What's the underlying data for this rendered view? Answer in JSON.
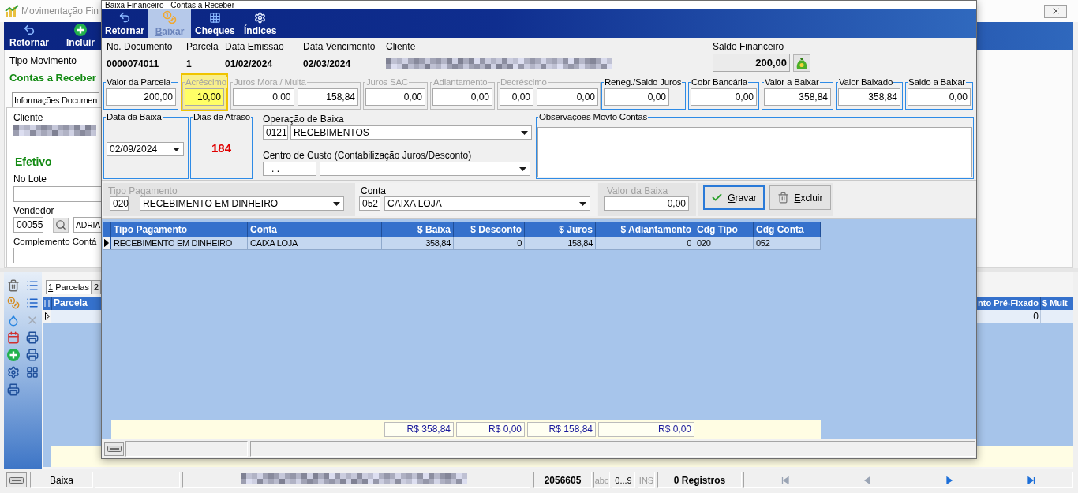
{
  "background_window": {
    "title": "Movimentação Fin",
    "toolbar": [
      {
        "label": "Retornar",
        "accelerator": false
      },
      {
        "label": "Incluir",
        "accelerator": true
      }
    ],
    "tipo_movimento": {
      "label": "Tipo Movimento",
      "value": "Contas a Receber"
    },
    "tabs": [
      {
        "label": "Informações Documen",
        "selected": true
      }
    ],
    "cliente": {
      "label": "Cliente",
      "redacted": true
    },
    "situacao": "Efetivo",
    "no_lote": {
      "label": "No Lote"
    },
    "vendedor": {
      "label": "Vendedor",
      "code": "00055",
      "name": "ADRIA"
    },
    "complemento": {
      "label": "Complemento Contá"
    },
    "side_tools": [
      {
        "disabled": false
      },
      {
        "disabled": false
      },
      {
        "disabled": false
      },
      {
        "disabled": false
      },
      {
        "disabled": false
      },
      {
        "disabled": true
      },
      {
        "disabled": false
      },
      {
        "disabled": false
      },
      {
        "disabled": false
      },
      {
        "disabled": false
      },
      {
        "disabled": false
      },
      {
        "disabled": false
      },
      {
        "disabled": false
      }
    ],
    "grid_tabs": [
      {
        "label": "1 Parcelas",
        "selected": true,
        "accelerator": true
      },
      {
        "label": "2",
        "selected": false,
        "accelerator": false
      }
    ],
    "grid": {
      "columns": [
        "Parcela",
        "nto Pré-Fixado",
        "$ Mult"
      ],
      "rows": [
        {
          "selected": false,
          "column_2": "0"
        }
      ]
    },
    "status_bar": {
      "mode": "Baixa",
      "redacted": true,
      "number": "2056605",
      "indicators": [
        {
          "label": "abc",
          "on": false
        },
        {
          "label": "0...9",
          "on": true
        },
        {
          "label": "INS",
          "on": false
        }
      ],
      "records": "0 Registros",
      "navigator": [
        {
          "disabled": true
        },
        {
          "disabled": true
        },
        {
          "disabled": false
        },
        {
          "disabled": false
        }
      ]
    }
  },
  "dialog": {
    "title": "Baixa Financeiro - Contas a Receber",
    "toolbar": [
      {
        "label": "Retornar",
        "selected": false,
        "accelerator": false
      },
      {
        "label": "Baixar",
        "selected": true,
        "accelerator": true
      },
      {
        "label": "Cheques",
        "selected": false,
        "accelerator": true
      },
      {
        "label": "Índices",
        "selected": false,
        "accelerator": true
      }
    ],
    "header": [
      {
        "kind": "text",
        "label": "No. Documento",
        "value": "0000074011"
      },
      {
        "kind": "text",
        "label": "Parcela",
        "value": "1"
      },
      {
        "kind": "text",
        "label": "Data Emissão",
        "value": "01/02/2024"
      },
      {
        "kind": "text",
        "label": "Data Vencimento",
        "value": "02/03/2024"
      },
      {
        "kind": "redacted",
        "label": "Cliente"
      }
    ],
    "saldo_financeiro": {
      "label": "Saldo Financeiro",
      "value": "200,00"
    },
    "amounts": [
      {
        "label": "Valor da Parcela",
        "disabled": false,
        "highlighted": false,
        "values": [
          "200,00"
        ]
      },
      {
        "label": "Acréscimo",
        "disabled": true,
        "highlighted": true,
        "values": [
          "10,00"
        ]
      },
      {
        "label": "Juros Mora / Multa",
        "disabled": true,
        "highlighted": false,
        "values": [
          "0,00",
          "158,84"
        ]
      },
      {
        "label": "Juros SAC",
        "disabled": true,
        "highlighted": false,
        "values": [
          "0,00"
        ]
      },
      {
        "label": "Adiantamento",
        "disabled": true,
        "highlighted": false,
        "values": [
          "0,00"
        ]
      },
      {
        "label": "Decréscimo",
        "disabled": true,
        "highlighted": false,
        "values": [
          "0,00",
          "0,00"
        ]
      },
      {
        "label": "Reneg./Saldo Juros",
        "disabled": false,
        "highlighted": false,
        "values": [
          "0,00"
        ]
      },
      {
        "label": "Cobr Bancária",
        "disabled": false,
        "highlighted": false,
        "values": [
          "0,00"
        ]
      },
      {
        "label": "Valor a Baixar",
        "disabled": false,
        "highlighted": false,
        "values": [
          "358,84"
        ]
      },
      {
        "label": "Valor Baixado",
        "disabled": false,
        "highlighted": false,
        "values": [
          "358,84"
        ]
      },
      {
        "label": "Saldo a Baixar",
        "disabled": false,
        "highlighted": false,
        "values": [
          "0,00"
        ]
      }
    ],
    "data_baixa": {
      "label": "Data da Baixa",
      "value": "02/09/2024"
    },
    "dias_atraso": {
      "label": "Dias de Atraso",
      "value": "184"
    },
    "operacao": {
      "label": "Operação de Baixa",
      "code": "0121",
      "value": "RECEBIMENTOS"
    },
    "centro_custo": {
      "label": "Centro de Custo (Contabilização Juros/Desconto)",
      "code": ". ."
    },
    "observacoes": {
      "label": "Observações Movto Contas"
    },
    "tipo_pagamento": {
      "label": "Tipo Pagamento",
      "disabled": true,
      "code": "020",
      "value": "RECEBIMENTO EM DINHEIRO"
    },
    "conta": {
      "label": "Conta",
      "disabled": false,
      "code": "052",
      "value": "CAIXA LOJA"
    },
    "valor_baixa": {
      "label": "Valor da Baixa",
      "disabled": true,
      "value": "0,00"
    },
    "actions": [
      {
        "label": "Gravar",
        "focused": true,
        "accelerator": true
      },
      {
        "label": "Excluir",
        "focused": false,
        "accelerator": true
      }
    ],
    "grid": {
      "columns": [
        "Tipo Pagamento",
        "Conta",
        "$ Baixa",
        "$ Desconto",
        "$ Juros",
        "$ Adiantamento",
        "Cdg Tipo",
        "Cdg Conta"
      ],
      "rows": [
        {
          "selected": true,
          "cells": [
            "RECEBIMENTO EM DINHEIRO",
            "CAIXA LOJA",
            "358,84",
            "0",
            "158,84",
            "0",
            "020",
            "052"
          ]
        }
      ],
      "totals": {
        "baixa": "R$ 358,84",
        "desconto": "R$ 0,00",
        "juros": "R$ 158,84",
        "adiantamento": "R$ 0,00"
      }
    }
  }
}
